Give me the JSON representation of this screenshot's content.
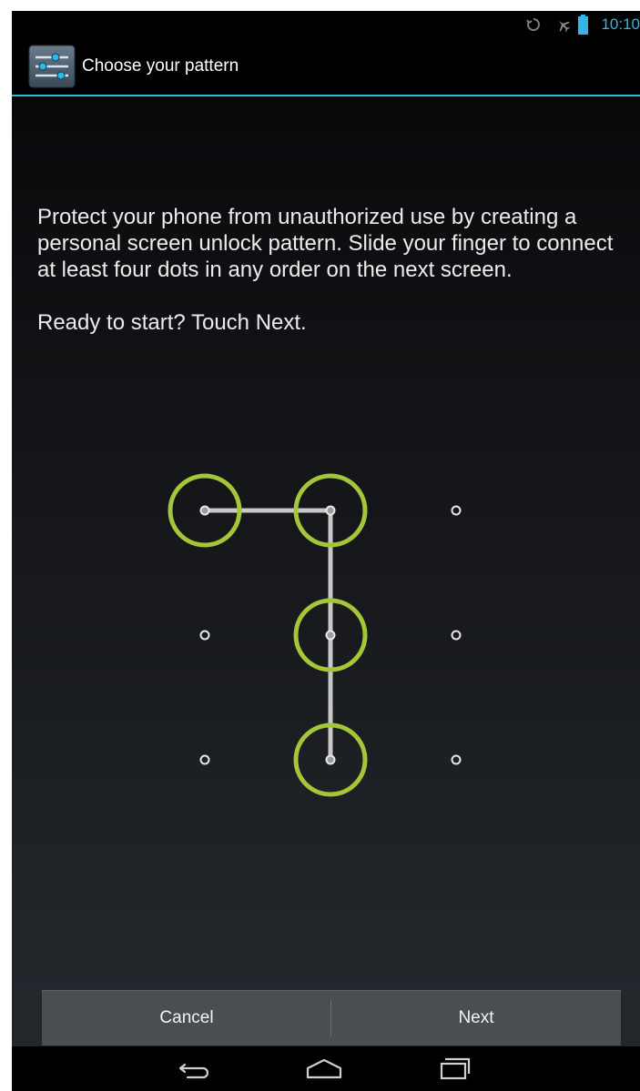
{
  "status_bar": {
    "clock": "10:10",
    "icons": [
      "sync-icon",
      "airplane-mode-icon",
      "battery-icon"
    ]
  },
  "action_bar": {
    "app_icon": "settings-sliders-icon",
    "title": "Choose your pattern"
  },
  "body": {
    "paragraph_1": "Protect your phone from unauthorized use by creating a personal screen unlock pattern. Slide your finger to connect at least four dots in any order on the next screen.",
    "paragraph_2": "Ready to start? Touch Next."
  },
  "pattern": {
    "grid": "3x3",
    "sequence": [
      1,
      2,
      5,
      8
    ],
    "highlight_color": "#a4c639",
    "line_color": "#c8c8c8"
  },
  "buttons": {
    "cancel_label": "Cancel",
    "next_label": "Next"
  },
  "nav_bar": {
    "icons": [
      "back-icon",
      "home-icon",
      "recents-icon"
    ]
  },
  "colors": {
    "accent": "#33b5e5",
    "pattern_ring": "#a4c639"
  }
}
